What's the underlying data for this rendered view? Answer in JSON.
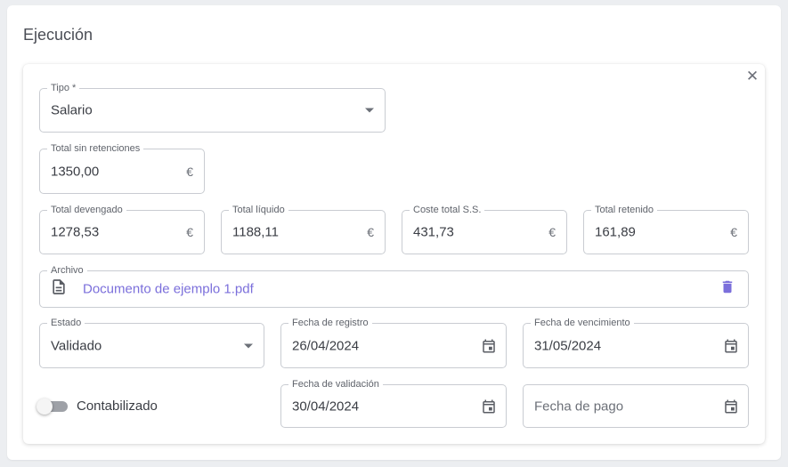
{
  "section": {
    "title": "Ejecución"
  },
  "form": {
    "close_icon": "close-icon",
    "tipo": {
      "label": "Tipo *",
      "value": "Salario"
    },
    "total_sin_retenciones": {
      "label": "Total sin retenciones",
      "value": "1350,00",
      "suffix": "€"
    },
    "total_devengado": {
      "label": "Total devengado",
      "value": "1278,53",
      "suffix": "€"
    },
    "total_liquido": {
      "label": "Total líquido",
      "value": "1188,11",
      "suffix": "€"
    },
    "coste_total_ss": {
      "label": "Coste total S.S.",
      "value": "431,73",
      "suffix": "€"
    },
    "total_retenido": {
      "label": "Total retenido",
      "value": "161,89",
      "suffix": "€"
    },
    "archivo": {
      "label": "Archivo",
      "file_name": "Documento de ejemplo 1.pdf",
      "icon": "document-icon",
      "delete_icon": "trash-icon"
    },
    "estado": {
      "label": "Estado",
      "value": "Validado"
    },
    "fecha_registro": {
      "label": "Fecha de registro",
      "value": "26/04/2024"
    },
    "fecha_vencimiento": {
      "label": "Fecha de vencimiento",
      "value": "31/05/2024"
    },
    "fecha_validacion": {
      "label": "Fecha de validación",
      "value": "30/04/2024"
    },
    "fecha_pago": {
      "placeholder": "Fecha de pago",
      "value": ""
    },
    "contabilizado": {
      "label": "Contabilizado",
      "checked": false
    }
  },
  "colors": {
    "accent": "#7b6fdb",
    "border": "#c9ccd2",
    "text": "#3a3d44"
  }
}
